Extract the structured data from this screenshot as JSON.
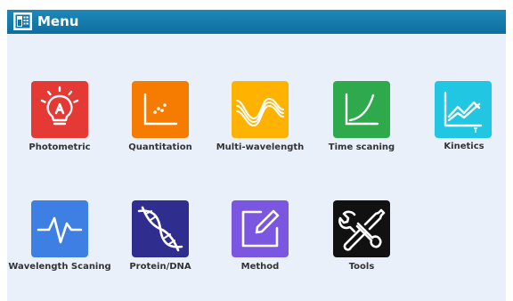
{
  "window": {
    "title": "Menu"
  },
  "menu": {
    "items": [
      {
        "label": "Photometric",
        "color": "#e53935",
        "icon": "lightbulb-icon"
      },
      {
        "label": "Quantitation",
        "color": "#f57c00",
        "icon": "scatter-plot-icon"
      },
      {
        "label": "Multi-wavelength",
        "color": "#ffb300",
        "icon": "waves-icon"
      },
      {
        "label": "Time scaning",
        "color": "#2eaa4c",
        "icon": "curve-icon"
      },
      {
        "label": "Kinetics",
        "color": "#21c6e2",
        "icon": "line-chart-icon"
      },
      {
        "label": "Wavelength Scaning",
        "color": "#3d7fe3",
        "icon": "pulse-icon"
      },
      {
        "label": "Protein/DNA",
        "color": "#2f2e8f",
        "icon": "dna-icon"
      },
      {
        "label": "Method",
        "color": "#7b56e0",
        "icon": "edit-icon"
      },
      {
        "label": "Tools",
        "color": "#111111",
        "icon": "tools-icon"
      }
    ]
  }
}
